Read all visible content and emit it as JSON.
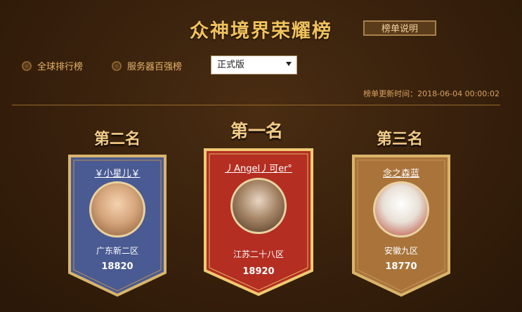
{
  "header": {
    "title": "众神境界荣耀榜",
    "explain_button": "榜单说明"
  },
  "filters": {
    "global_radio": "全球排行榜",
    "server_radio": "服务器百强榜",
    "version_select": "正式版"
  },
  "update_time": "榜单更新时间：2018-06-04 00:00:02",
  "podium": [
    {
      "rank_label": "第二名",
      "name": "￥小星儿￥",
      "server": "广东新二区",
      "score": "18820",
      "color": "#4a5a93"
    },
    {
      "rank_label": "第一名",
      "name": "丿Angel丿可er°",
      "server": "江苏二十八区",
      "score": "18920",
      "color": "#b42e22"
    },
    {
      "rank_label": "第三名",
      "name": "念之森蓝",
      "server": "安徽九区",
      "score": "18770",
      "color": "#a9733a"
    }
  ]
}
